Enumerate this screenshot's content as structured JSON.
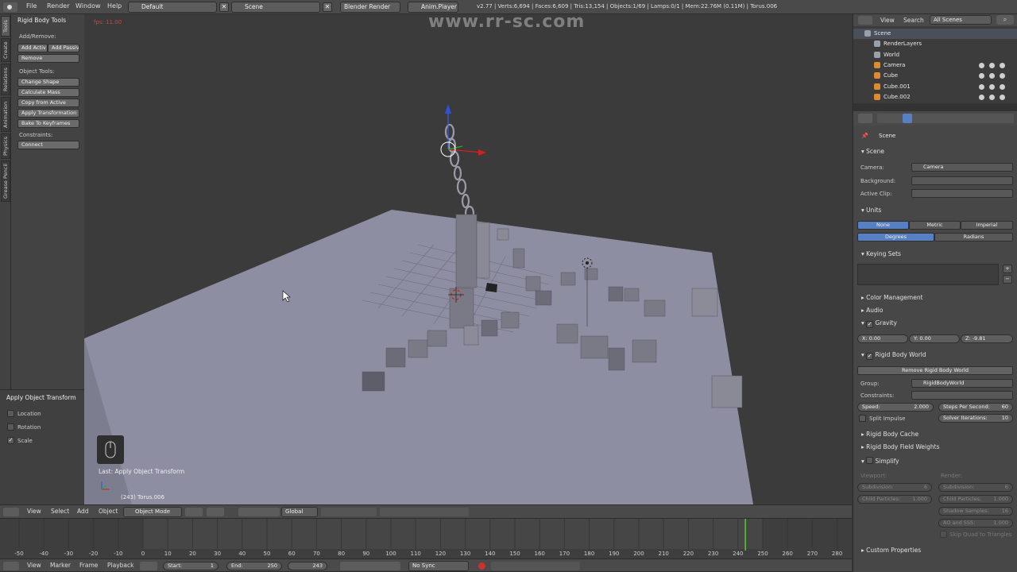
{
  "topbar": {
    "menus": [
      "File",
      "Render",
      "Window",
      "Help"
    ],
    "screen_layout": "Default",
    "scene": "Scene",
    "engine": "Blender Render",
    "anim_player": "Anim.Player",
    "stats": "v2.77 | Verts:6,694 | Faces:6,609 | Tris:13,154 | Objects:1/69 | Lamps:0/1 | Mem:22.76M (0.11M) | Torus.006"
  },
  "watermark": "www.rr-sc.com",
  "left_tabs": [
    "Tools",
    "Create",
    "Relations",
    "Animation",
    "Physics",
    "Grease Pencil"
  ],
  "toolpanel": {
    "title": "Rigid Body Tools",
    "add_remove_label": "Add/Remove:",
    "add_active": "Add Activ",
    "add_passive": "Add Passiv",
    "remove": "Remove",
    "object_tools_label": "Object Tools:",
    "object_tools": [
      "Change Shape",
      "Calculate Mass",
      "Copy from Active",
      "Apply Transformation",
      "Bake To Keyframes"
    ],
    "constraints_label": "Constraints:",
    "connect": "Connect"
  },
  "operator_panel": {
    "title": "Apply Object Transform",
    "options": [
      {
        "label": "Location",
        "checked": false
      },
      {
        "label": "Rotation",
        "checked": false
      },
      {
        "label": "Scale",
        "checked": true
      }
    ]
  },
  "viewport": {
    "fps": "fps: 11.00",
    "last_op": "Last: Apply Object Transform",
    "frame_object": "(243) Torus.006"
  },
  "view3d_header": {
    "menus": [
      "View",
      "Select",
      "Add",
      "Object"
    ],
    "mode": "Object Mode",
    "orientation": "Global"
  },
  "timeline": {
    "ticks": [
      -50,
      -40,
      -30,
      -20,
      -10,
      0,
      10,
      20,
      30,
      40,
      50,
      60,
      70,
      80,
      90,
      100,
      110,
      120,
      130,
      140,
      150,
      160,
      170,
      180,
      190,
      200,
      210,
      220,
      230,
      240,
      250,
      260,
      270,
      280
    ],
    "current_frame": 243,
    "menus": [
      "View",
      "Marker",
      "Frame",
      "Playback"
    ],
    "start_label": "Start:",
    "start": "1",
    "end_label": "End:",
    "end": "250",
    "frame": "243",
    "sync": "No Sync"
  },
  "outliner": {
    "menus": [
      "View",
      "Search"
    ],
    "filter": "All Scenes",
    "items": [
      {
        "name": "Scene",
        "level": 0
      },
      {
        "name": "RenderLayers",
        "level": 1
      },
      {
        "name": "World",
        "level": 1
      },
      {
        "name": "Camera",
        "level": 1
      },
      {
        "name": "Cube",
        "level": 1
      },
      {
        "name": "Cube.001",
        "level": 1
      },
      {
        "name": "Cube.002",
        "level": 1
      }
    ]
  },
  "properties": {
    "context": "Scene",
    "scene_section": "Scene",
    "camera_label": "Camera:",
    "camera_value": "Camera",
    "background_label": "Background:",
    "active_clip_label": "Active Clip:",
    "units_section": "Units",
    "units": [
      "None",
      "Metric",
      "Imperial"
    ],
    "units_active": "None",
    "rotation_units": [
      "Degrees",
      "Radians"
    ],
    "rotation_active": "Degrees",
    "keying_sets": "Keying Sets",
    "color_management": "Color Management",
    "audio": "Audio",
    "gravity": "Gravity",
    "gravity_x": "X:       0.00",
    "gravity_y": "Y:       0.00",
    "gravity_z": "Z:      -9.81",
    "rigid_world": "Rigid Body World",
    "remove_world": "Remove Rigid Body World",
    "group_label": "Group:",
    "group_value": "RigidBodyWorld",
    "constraints_label": "Constraints:",
    "speed": "Speed:",
    "speed_value": "2.000",
    "steps": "Steps Per Second:",
    "steps_value": "60",
    "split_impulse": "Split Impulse",
    "solver": "Solver Iterations:",
    "solver_value": "10",
    "cache": "Rigid Body Cache",
    "field_weights": "Rigid Body Field Weights",
    "simplify": "Simplify",
    "viewport_label": "Viewport:",
    "render_label": "Render:",
    "subdivision": "Subdivision:",
    "subdivision_value": "6",
    "child_particles": "Child Particles:",
    "child_particles_value": "1.000",
    "render_subdivision": "Subdivision:",
    "render_subdivision_value": "6",
    "render_child": "Child Particles:",
    "render_child_value": "1.000",
    "shadow_samples": "Shadow Samples:",
    "shadow_samples_value": "16",
    "ao_sss": "AO and SSS:",
    "ao_sss_value": "1.000",
    "skip_quad": "Skip Quad to Triangles",
    "custom_props": "Custom Properties"
  },
  "colors": {
    "accent_blue": "#5680c2",
    "frame_line": "#60c040",
    "fps_red": "#e03c3c"
  }
}
